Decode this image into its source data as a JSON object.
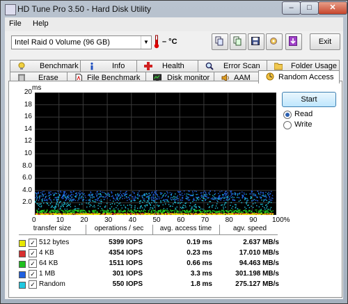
{
  "window": {
    "title": "HD Tune Pro 3.50 - Hard Disk Utility",
    "min_label": "–",
    "max_label": "□",
    "close_label": "✕"
  },
  "menu": [
    "File",
    "Help"
  ],
  "toolbar": {
    "drive": "Intel   Raid 0 Volume (96 GB)",
    "temperature": "– °C",
    "exit_label": "Exit",
    "buttons": [
      "copy-info-icon",
      "copy-text-icon",
      "save-icon",
      "options-icon",
      "download-icon"
    ]
  },
  "tabs_row1": [
    {
      "label": "Benchmark",
      "icon": "benchmark-icon"
    },
    {
      "label": "Info",
      "icon": "info-icon"
    },
    {
      "label": "Health",
      "icon": "health-icon"
    },
    {
      "label": "Error Scan",
      "icon": "error-scan-icon"
    },
    {
      "label": "Folder Usage",
      "icon": "folder-icon"
    }
  ],
  "tabs_row2": [
    {
      "label": "Erase",
      "icon": "erase-icon"
    },
    {
      "label": "File Benchmark",
      "icon": "file-benchmark-icon"
    },
    {
      "label": "Disk monitor",
      "icon": "disk-monitor-icon"
    },
    {
      "label": "AAM",
      "icon": "aam-icon"
    },
    {
      "label": "Random Access",
      "icon": "random-access-icon"
    }
  ],
  "chart_data": {
    "type": "scatter",
    "title": "",
    "xlabel": "",
    "ylabel": "ms",
    "xlim": [
      0,
      100
    ],
    "ylim": [
      0,
      20
    ],
    "x_ticks": [
      "0",
      "10",
      "20",
      "30",
      "40",
      "50",
      "60",
      "70",
      "80",
      "90",
      "100%"
    ],
    "y_ticks": [
      "20",
      "18",
      "16",
      "14",
      "12",
      "10",
      "8.0",
      "6.0",
      "4.0",
      "2.0"
    ],
    "grid": true,
    "series": [
      {
        "name": "512 bytes",
        "color": "#e8e800",
        "band": [
          0.1,
          0.3
        ]
      },
      {
        "name": "4 KB",
        "color": "#d83030",
        "band": [
          0.15,
          0.35
        ]
      },
      {
        "name": "64 KB",
        "color": "#20d020",
        "band": [
          0.4,
          0.9
        ]
      },
      {
        "name": "1 MB",
        "color": "#2060e0",
        "band": [
          2.4,
          4.0
        ]
      },
      {
        "name": "Random",
        "color": "#20c8e0",
        "band": [
          1.0,
          3.6
        ]
      }
    ]
  },
  "controls": {
    "start_label": "Start",
    "read_label": "Read",
    "write_label": "Write",
    "selected": "Read"
  },
  "results": {
    "headers": [
      "transfer size",
      "operations / sec",
      "avg. access time",
      "agv. speed"
    ],
    "rows": [
      {
        "name": "512 bytes",
        "color": "#e8e800",
        "checked": "✓",
        "ops": "5399 IOPS",
        "access": "0.19 ms",
        "speed": "2.637 MB/s"
      },
      {
        "name": "4 KB",
        "color": "#d83030",
        "checked": "✓",
        "ops": "4354 IOPS",
        "access": "0.23 ms",
        "speed": "17.010 MB/s"
      },
      {
        "name": "64 KB",
        "color": "#20c020",
        "checked": "✓",
        "ops": "1511 IOPS",
        "access": "0.66 ms",
        "speed": "94.463 MB/s"
      },
      {
        "name": "1 MB",
        "color": "#2060e0",
        "checked": "✓",
        "ops": "301 IOPS",
        "access": "3.3 ms",
        "speed": "301.198 MB/s"
      },
      {
        "name": "Random",
        "color": "#20c8e0",
        "checked": "✓",
        "ops": "550 IOPS",
        "access": "1.8 ms",
        "speed": "275.127 MB/s"
      }
    ]
  }
}
